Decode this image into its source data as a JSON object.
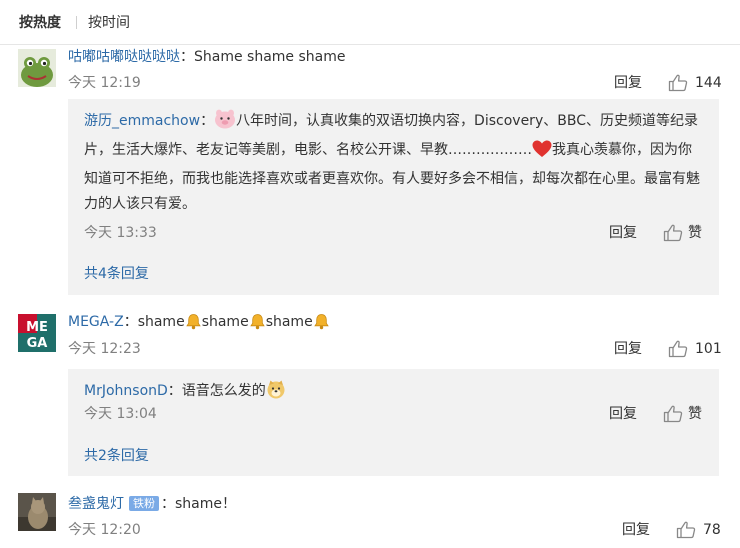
{
  "tabs": {
    "hot": "按热度",
    "time": "按时间"
  },
  "comments": [
    {
      "user": "咕嘟咕嘟哒哒哒哒",
      "sep": "：",
      "text": "Shame shame shame",
      "time": "今天 12:19",
      "reply": "回复",
      "likes": "144",
      "sub_replies": [
        {
          "user": "游历_emmachow",
          "sep": "：",
          "text_a": "八年时间，认真收集的双语切换内容，Discovery、BBC、历史频道等纪录片，生活大爆炸、老友记等美剧，电影、名校公开课、早教………………",
          "text_b": "我真心羡慕你，因为你知道可不拒绝，而我也能选择喜欢或者更喜欢你。有人要好多会不相信，却每次都在心里。最富有魅力的人该只有爱。",
          "time": "今天 13:33",
          "reply": "回复",
          "like": "赞",
          "emojis": [
            "pig-face-icon",
            "red-heart-icon"
          ]
        }
      ],
      "more": "共4条回复"
    },
    {
      "user": "MEGA-Z",
      "sep": "：",
      "text_parts": [
        "shame",
        "shame",
        "shame"
      ],
      "emoji": "bell-icon",
      "time": "今天 12:23",
      "reply": "回复",
      "likes": "101",
      "sub_replies": [
        {
          "user": "MrJohnsonD",
          "sep": "：",
          "text": "语音怎么发的",
          "emoji": "doge-icon",
          "time": "今天 13:04",
          "reply": "回复",
          "like": "赞"
        }
      ],
      "more": "共2条回复"
    },
    {
      "user": "叁盏鬼灯",
      "badge": "铁粉",
      "sep": "：",
      "text": "shame！",
      "time": "今天 12:20",
      "reply": "回复",
      "likes": "78"
    }
  ],
  "avatar_texts": {
    "mega": "MEGA"
  },
  "colors": {
    "link": "#2d6aa7",
    "meta": "#808080",
    "sub_bg": "#f2f2f2",
    "badge": "#7aaae6",
    "heart": "#e0322f",
    "bell": "#f2b12a"
  }
}
